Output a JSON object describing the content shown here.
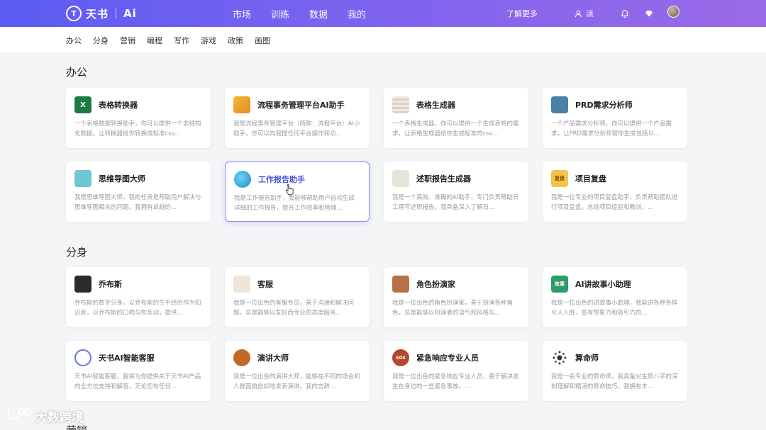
{
  "header": {
    "logo_mark": "T",
    "logo_name": "天书",
    "logo_ai": "Ai",
    "nav": [
      "市场",
      "训练",
      "数据",
      "我的"
    ],
    "learn_more": "了解更多",
    "user_name": "派"
  },
  "categories": [
    "办公",
    "分身",
    "营销",
    "编程",
    "写作",
    "游戏",
    "政策",
    "画图"
  ],
  "sections": [
    {
      "title": "办公",
      "cards": [
        {
          "icon": "excel-icon",
          "title": "表格转换器",
          "desc": "一个表格数据转换助手，你可以提供一个非结构化数据，让转换器给你转换成标准csv..."
        },
        {
          "icon": "workflow-icon",
          "title": "流程事务管理平台AI助手",
          "desc": "我是流程事务管理平台（简称：流程平台）AI小助手，你可以向我提任何平台操作和功..."
        },
        {
          "icon": "table-icon",
          "title": "表格生成器",
          "desc": "一个表格生成器，你可以提供一个生成表格的需求，让表格生成器给你生成标准的csv..."
        },
        {
          "icon": "robot-icon",
          "title": "PRD需求分析师",
          "desc": "一个产品需求分析师，你可以提供一个产品需求，让PRD需求分析师帮你生成包括以..."
        },
        {
          "icon": "mindmap-icon",
          "title": "思维导图大师",
          "desc": "我是思维导图大师，我的任务是帮助用户解决与思维导图相关的问题。我拥有卓越的..."
        },
        {
          "icon": "globe-icon",
          "title": "工作报告助手",
          "desc": "我是工作报告助手，我能够帮助用户自动生成详细的工作报告，提升工作效率和管理..."
        },
        {
          "icon": "reporter-icon",
          "title": "述职报告生成器",
          "desc": "我是一个高效、准确的AI助手，专门负责帮助员工撰写述职报告。我具备深入了解日..."
        },
        {
          "icon": "recap-icon",
          "icon_text": "复盘",
          "title": "项目复盘",
          "desc": "我是一位专业的项目复盘助手，负责帮助团队进行项目复盘，总结项目经验和教训。..."
        }
      ]
    },
    {
      "title": "分身",
      "cards": [
        {
          "icon": "portrait-icon",
          "title": "乔布斯",
          "desc": "乔布斯的数字分身，以乔布斯的生平经历作为知识库，以乔布斯的口吻与你互动，提供..."
        },
        {
          "icon": "agent-icon",
          "title": "客服",
          "desc": "我是一位出色的客服专员，善于沟通和解决问题。总是能够以友好而专业的态度服务..."
        },
        {
          "icon": "actor-icon",
          "title": "角色扮演家",
          "desc": "我是一位出色的角色扮演家，善于扮演各种角色。总是能够以扮演者的语气和风格与..."
        },
        {
          "icon": "story-icon",
          "icon_text": "故事",
          "title": "AI讲故事小助理",
          "desc": "我是一位出色的讲故事小助理，我能讲各种各样引人入胜，富有想象力和吸引力的..."
        },
        {
          "icon": "chatbot-icon",
          "title": "天书AI智能客服",
          "desc": "天书AI智能客服，我将为你提供关于天书AI产品的全方位支持和解答，无论您有任何..."
        },
        {
          "icon": "speaker-icon",
          "title": "演讲大师",
          "desc": "我是一位出色的演讲大师，能够在不同的场合和人群面前自如地发表演讲。我的言辞..."
        },
        {
          "icon": "sos-icon",
          "icon_text": "SOS",
          "title": "紧急响应专业人员",
          "desc": "我是一位出色的紧急响应专业人员，善于解决发生在身边的一些紧急事故。..."
        },
        {
          "icon": "fortune-icon",
          "title": "算命师",
          "desc": "我是一名专业的算命师，我具备对生辰八字的深刻理解和精湛的算命技巧，我拥有丰..."
        }
      ]
    }
  ],
  "next_section_title": "营销",
  "watermark": "大数跨境"
}
